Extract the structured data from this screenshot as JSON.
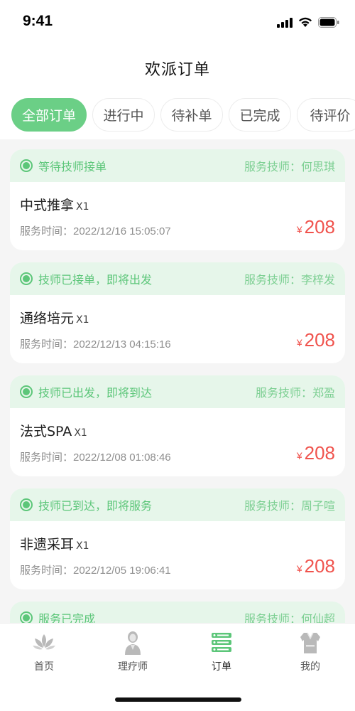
{
  "status_bar": {
    "time": "9:41"
  },
  "nav": {
    "title": "欢派订单"
  },
  "filter_tabs": [
    {
      "label": "全部订单",
      "active": true
    },
    {
      "label": "进行中",
      "active": false
    },
    {
      "label": "待补单",
      "active": false
    },
    {
      "label": "已完成",
      "active": false
    },
    {
      "label": "待评价",
      "active": false
    }
  ],
  "orders": [
    {
      "status": "等待技师接单",
      "technician": "服务技师：何思琪",
      "service": "中式推拿",
      "qty": "X1",
      "time": "服务时间：2022/12/16 15:05:07",
      "currency": "¥",
      "price": "208"
    },
    {
      "status": "技师已接单，即将出发",
      "technician": "服务技师：李梓发",
      "service": "通络培元",
      "qty": "X1",
      "time": "服务时间：2022/12/13 04:15:16",
      "currency": "¥",
      "price": "208"
    },
    {
      "status": "技师已出发，即将到达",
      "technician": "服务技师：郑盈",
      "service": "法式SPA",
      "qty": "X1",
      "time": "服务时间：2022/12/08 01:08:46",
      "currency": "¥",
      "price": "208"
    },
    {
      "status": "技师已到达，即将服务",
      "technician": "服务技师：周子喧",
      "service": "非遗采耳",
      "qty": "X1",
      "time": "服务时间：2022/12/05 19:06:41",
      "currency": "¥",
      "price": "208"
    },
    {
      "status": "服务已完成",
      "technician": "服务技师：何仙超",
      "service": "",
      "qty": "",
      "time": "",
      "currency": "",
      "price": ""
    }
  ],
  "tabbar": [
    {
      "label": "首页",
      "icon": "lotus-icon",
      "active": false
    },
    {
      "label": "理疗师",
      "icon": "therapist-icon",
      "active": false
    },
    {
      "label": "订单",
      "icon": "order-list-icon",
      "active": true
    },
    {
      "label": "我的",
      "icon": "profile-robe-icon",
      "active": false
    }
  ],
  "colors": {
    "accent": "#6bcf86",
    "status_green": "#5cc679",
    "price_red": "#f0534d",
    "header_bg": "#e6f6ea"
  }
}
